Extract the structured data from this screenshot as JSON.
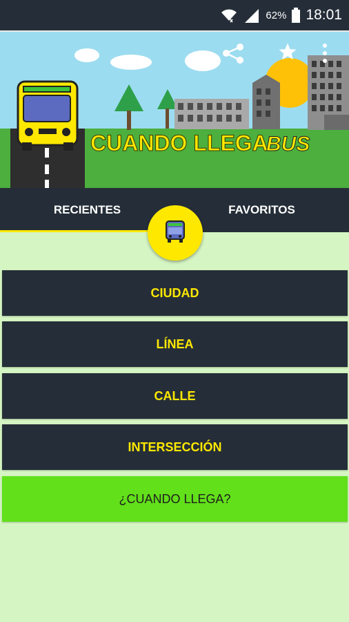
{
  "status_bar": {
    "battery": "62%",
    "time": "18:01"
  },
  "header": {
    "title": "CUANDO LLEGA",
    "title_suffix": "BUS"
  },
  "tabs": [
    {
      "label": "RECIENTES",
      "active": true
    },
    {
      "label": "FAVORITOS",
      "active": false
    }
  ],
  "menu": {
    "ciudad": "CIUDAD",
    "linea": "LÍNEA",
    "calle": "CALLE",
    "interseccion": "INTERSECCIÓN",
    "submit": "¿CUANDO LLEGA?"
  },
  "colors": {
    "dark": "#252e38",
    "accent_yellow": "#ffe800",
    "accent_green": "#62e01a",
    "background": "#d5f5c3"
  }
}
